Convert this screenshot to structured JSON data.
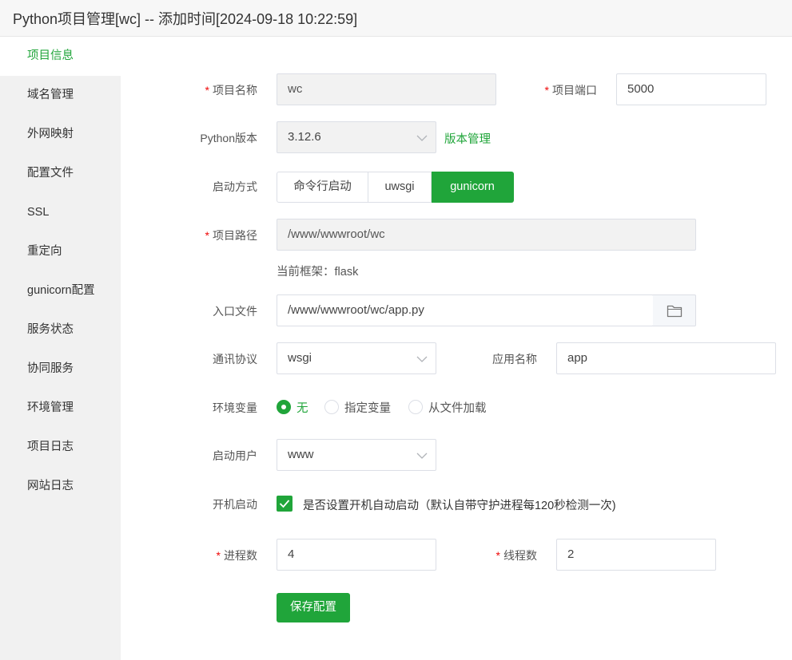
{
  "window": {
    "title": "Python项目管理[wc] -- 添加时间[2024-09-18 10:22:59]"
  },
  "sidebar": {
    "items": [
      {
        "label": "项目信息",
        "active": true
      },
      {
        "label": "域名管理"
      },
      {
        "label": "外网映射"
      },
      {
        "label": "配置文件"
      },
      {
        "label": "SSL"
      },
      {
        "label": "重定向"
      },
      {
        "label": "gunicorn配置"
      },
      {
        "label": "服务状态"
      },
      {
        "label": "协同服务"
      },
      {
        "label": "环境管理"
      },
      {
        "label": "项目日志"
      },
      {
        "label": "网站日志"
      }
    ]
  },
  "form": {
    "required_mark": "*",
    "project_name": {
      "label": "项目名称",
      "value": "wc"
    },
    "project_port": {
      "label": "项目端口",
      "value": "5000"
    },
    "python_version": {
      "label": "Python版本",
      "value": "3.12.6",
      "link": "版本管理"
    },
    "start_mode": {
      "label": "启动方式",
      "options": [
        "命令行启动",
        "uwsgi",
        "gunicorn"
      ],
      "selected": "gunicorn"
    },
    "project_path": {
      "label": "项目路径",
      "value": "/www/wwwroot/wc"
    },
    "framework_hint": "当前框架：flask",
    "entry_file": {
      "label": "入口文件",
      "value": "/www/wwwroot/wc/app.py",
      "icon": "folder-icon"
    },
    "protocol": {
      "label": "通讯协议",
      "value": "wsgi"
    },
    "app_name": {
      "label": "应用名称",
      "value": "app"
    },
    "env_vars": {
      "label": "环境变量",
      "options": [
        "无",
        "指定变量",
        "从文件加载"
      ],
      "selected": "无"
    },
    "start_user": {
      "label": "启动用户",
      "value": "www"
    },
    "autostart": {
      "label": "开机启动",
      "checked": true,
      "text": "是否设置开机自动启动（默认自带守护进程每120秒检测一次)"
    },
    "processes": {
      "label": "进程数",
      "value": "4"
    },
    "threads": {
      "label": "线程数",
      "value": "2"
    },
    "save_label": "保存配置"
  },
  "colors": {
    "accent": "#20a53a",
    "required": "#ef0808",
    "sidebar_bg": "#f1f1f1",
    "disabled_bg": "#f2f2f2"
  }
}
